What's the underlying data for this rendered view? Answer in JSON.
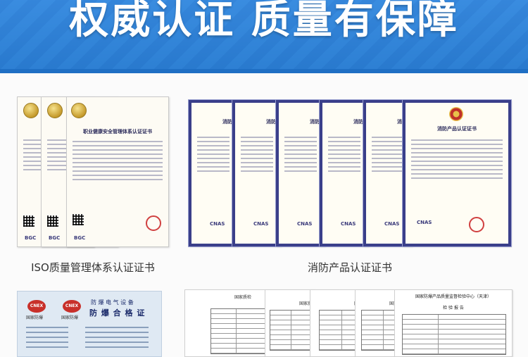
{
  "banner": {
    "title": "权威认证 质量有保障",
    "background": "#2a7fd8"
  },
  "certificates": {
    "iso": {
      "caption": "ISO质量管理体系认证证书",
      "title": "职业健康安全管理体系认证证书",
      "logo": "BGC"
    },
    "fire": {
      "caption": "消防产品认证证书",
      "title_front": "消防产品认证证书",
      "title_back": "消防",
      "logo": "CNAS"
    },
    "explosion": {
      "brand": "CNEX",
      "brand_sub": "国家防爆",
      "header": "防 爆 电 气 设 备",
      "title": "防 爆 合 格 证"
    },
    "report": {
      "header": "国家防爆产品质量监督检验中心（天津）",
      "subheader": "检 验 报 告",
      "small": "国家质检"
    }
  }
}
